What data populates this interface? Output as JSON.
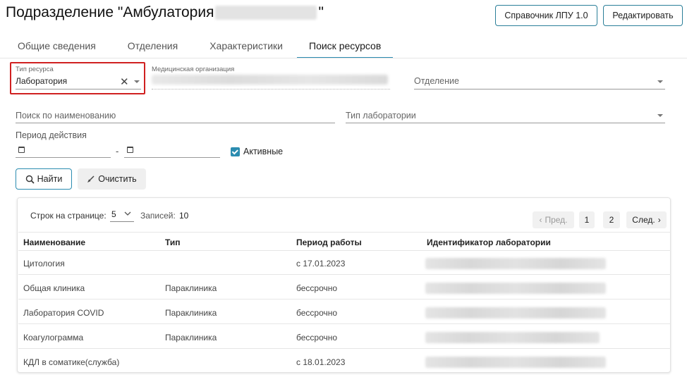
{
  "header": {
    "title_prefix": "Подразделение \"Амбулатория",
    "title_suffix": "\"",
    "btn_handbook": "Справочник ЛПУ 1.0",
    "btn_edit": "Редактировать"
  },
  "tabs": [
    {
      "label": "Общие сведения"
    },
    {
      "label": "Отделения"
    },
    {
      "label": "Характеристики"
    },
    {
      "label": "Поиск ресурсов"
    }
  ],
  "filters": {
    "resource_type_label": "Тип ресурса",
    "resource_type_value": "Лаборатория",
    "med_org_label": "Медицинская организация",
    "department_placeholder": "Отделение",
    "search_name_placeholder": "Поиск по наименованию",
    "lab_type_placeholder": "Тип лаборатории",
    "period_label": "Период действия",
    "date_separator": "-",
    "active_label": "Активные",
    "active_checked": true
  },
  "actions": {
    "find_label": "Найти",
    "clear_label": "Очистить"
  },
  "pagination": {
    "rows_per_page_label": "Строк на странице:",
    "rows_per_page_value": "5",
    "records_label": "Записей:",
    "records_count": "10",
    "prev_label": "Пред.",
    "next_label": "След.",
    "pages": [
      "1",
      "2"
    ],
    "current_page": "1"
  },
  "table": {
    "columns": [
      "Наименование",
      "Тип",
      "Период работы",
      "Идентификатор лаборатории"
    ],
    "rows": [
      {
        "name": "Цитология",
        "type": "",
        "period": "с 17.01.2023"
      },
      {
        "name": "Общая клиника",
        "type": "Параклиника",
        "period": "бессрочно"
      },
      {
        "name": "Лаборатория COVID",
        "type": "Параклиника",
        "period": "бессрочно"
      },
      {
        "name": "Коагулограмма",
        "type": "Параклиника",
        "period": "бессрочно"
      },
      {
        "name": "КДЛ в соматике(служба)",
        "type": "",
        "period": "с 18.01.2023"
      }
    ]
  },
  "colors": {
    "accent": "#2b8cb0",
    "highlight_border": "#d02020"
  }
}
